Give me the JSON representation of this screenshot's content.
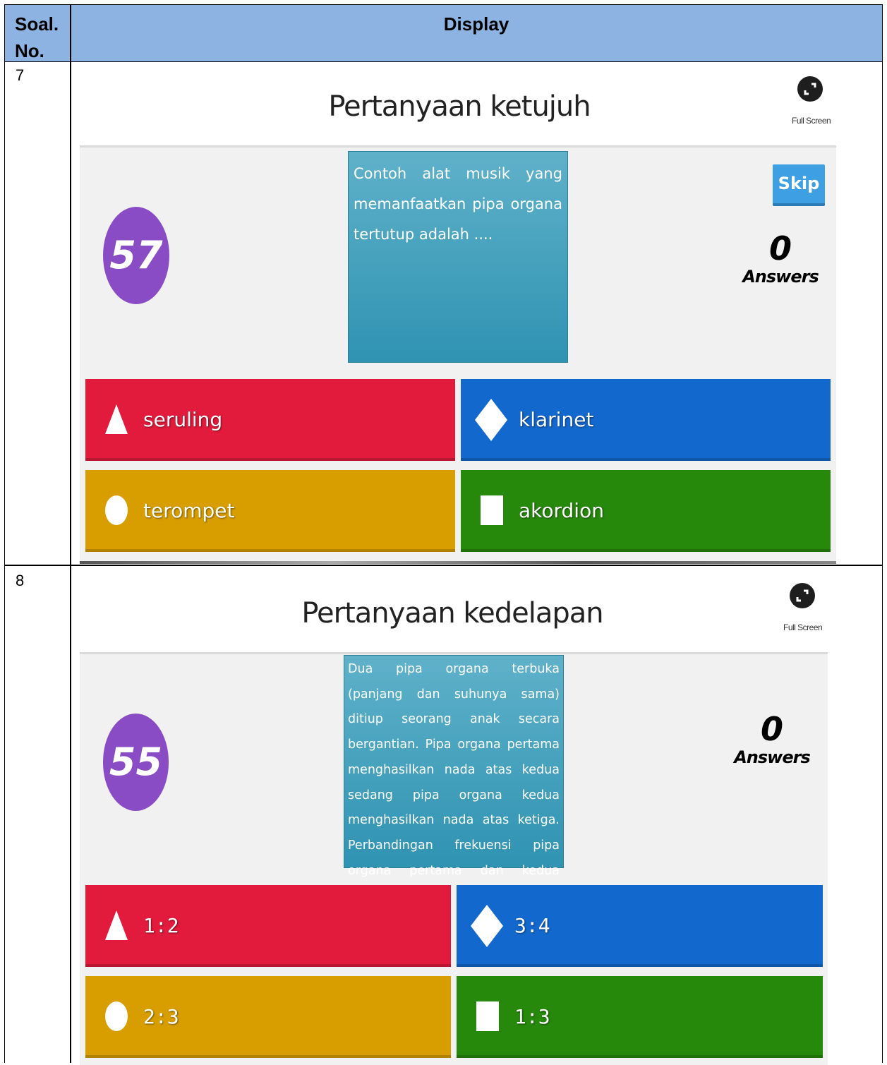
{
  "table": {
    "col_soal_header": "Soal.\nNo.",
    "col_soal_line1": "Soal.",
    "col_soal_line2": "No.",
    "col_display_header": "Display"
  },
  "rows": [
    {
      "number": "7",
      "title": "Pertanyaan ketujuh",
      "fullscreen_label": "Full Screen",
      "timer": "57",
      "question": "Contoh alat musik yang memanfaatkan pipa organa tertutup adalah ....",
      "skip_label": "Skip",
      "answers_count": "0",
      "answers_label": "Answers",
      "options": [
        {
          "shape": "triangle-icon",
          "label": "seruling",
          "color": "#e21b3c"
        },
        {
          "shape": "diamond-icon",
          "label": "klarinet",
          "color": "#1368ce"
        },
        {
          "shape": "circle-icon",
          "label": "terompet",
          "color": "#d89e00"
        },
        {
          "shape": "square-icon",
          "label": "akordion",
          "color": "#26890c"
        }
      ]
    },
    {
      "number": "8",
      "title": "Pertanyaan kedelapan",
      "fullscreen_label": "Full Screen",
      "timer": "55",
      "question": "Dua pipa organa terbuka (panjang dan suhunya sama) ditiup seorang anak secara bergantian. Pipa organa pertama menghasilkan nada atas kedua sedang pipa organa kedua menghasilkan nada atas ketiga. Perbandingan frekuensi pipa organa pertama dan kedua adalah ....",
      "answers_count": "0",
      "answers_label": "Answers",
      "options": [
        {
          "shape": "triangle-icon",
          "label": "1:2",
          "color": "#e21b3c"
        },
        {
          "shape": "diamond-icon",
          "label": "3:4",
          "color": "#1368ce"
        },
        {
          "shape": "circle-icon",
          "label": "2:3",
          "color": "#d89e00"
        },
        {
          "shape": "square-icon",
          "label": "1:3",
          "color": "#26890c"
        }
      ]
    }
  ]
}
